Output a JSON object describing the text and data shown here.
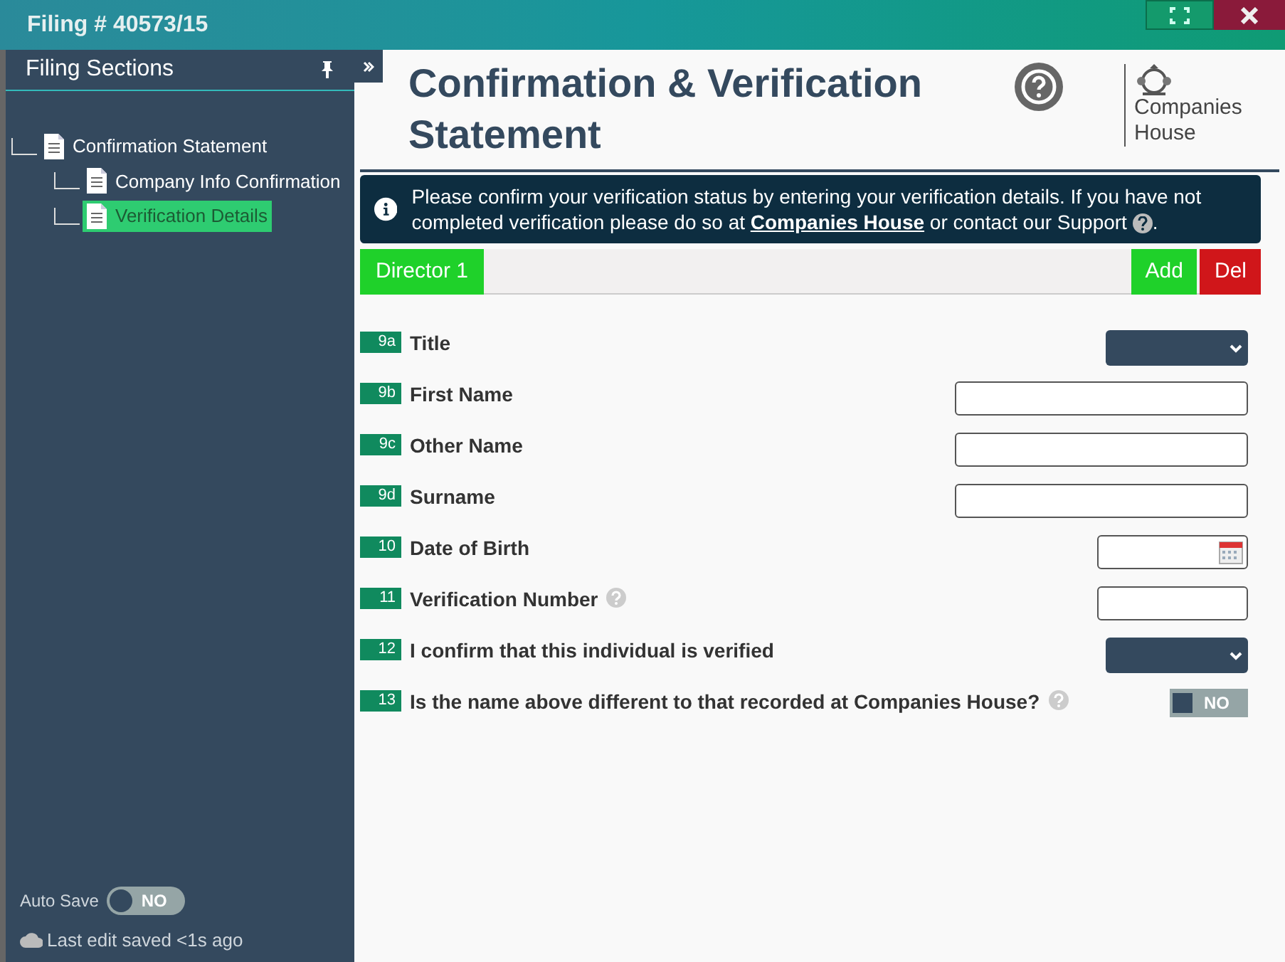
{
  "window": {
    "title": "Filing # 40573/15"
  },
  "sidebar": {
    "title": "Filing Sections",
    "tree": [
      {
        "label": "Confirmation Statement",
        "selected": false,
        "children": [
          {
            "label": "Company Info Confirmation",
            "selected": false
          },
          {
            "label": "Verification Details",
            "selected": true
          }
        ]
      }
    ],
    "auto_save": {
      "label": "Auto Save",
      "on": false,
      "state_text": "NO"
    },
    "saved_text": "Last edit saved <1s ago"
  },
  "header": {
    "title": "Confirmation & Verification Statement",
    "logo_text": "Companies House"
  },
  "info": {
    "text_before": "Please confirm your verification status by entering your verification details. If you have not completed verification please do so at",
    "link": "Companies House",
    "text_after": "or contact our Support",
    "end": "."
  },
  "directors": [
    {
      "label": "Director 1",
      "selected": true
    }
  ],
  "actions": [
    "Add",
    "Del"
  ],
  "fields": [
    {
      "number": "9a",
      "label": "Title",
      "kind": "select",
      "help": false
    },
    {
      "number": "9b",
      "label": "First Name",
      "kind": "text",
      "help": false
    },
    {
      "number": "9c",
      "label": "Other Name",
      "kind": "text",
      "help": false
    },
    {
      "number": "9d",
      "label": "Surname",
      "kind": "text",
      "help": false
    },
    {
      "number": "10",
      "label": "Date of Birth",
      "kind": "date",
      "help": false
    },
    {
      "number": "11",
      "label": "Verification Number",
      "kind": "short",
      "help": true
    },
    {
      "number": "12",
      "label": "I confirm that this individual is verified",
      "kind": "select",
      "help": false
    },
    {
      "number": "13",
      "label": "Is the name above different to that recorded at Companies House?",
      "kind": "toggle",
      "help": true,
      "on": false,
      "state_text": "NO"
    }
  ]
}
